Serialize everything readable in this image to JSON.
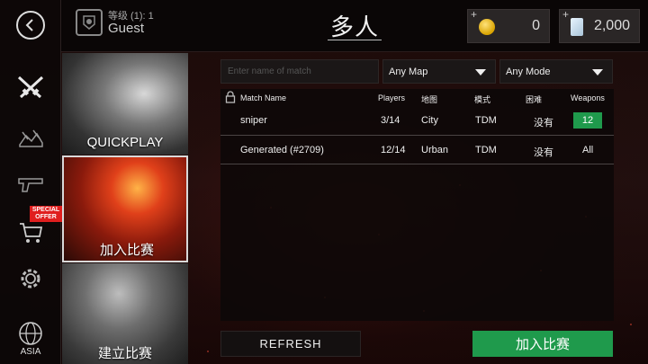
{
  "header": {
    "title": "多人",
    "profile": {
      "level": "等级 (1): 1",
      "name": "Guest"
    },
    "coins": {
      "plus": "+",
      "value": "0"
    },
    "cards": {
      "plus": "+",
      "value": "2,000"
    }
  },
  "sidebar": {
    "offer_badge": "SPECIAL OFFER",
    "region": "ASIA"
  },
  "modes": [
    {
      "label": "QUICKPLAY"
    },
    {
      "label": "加入比赛"
    },
    {
      "label": "建立比赛"
    }
  ],
  "filters": {
    "search_placeholder": "Enter name of match",
    "map": "Any Map",
    "mode": "Any Mode"
  },
  "table": {
    "columns": [
      "Match Name",
      "Players",
      "地图",
      "模式",
      "困难",
      "Weapons"
    ],
    "rows": [
      {
        "name": "sniper",
        "players": "3/14",
        "map": "City",
        "mode": "TDM",
        "difficulty": "没有",
        "weapons": "12"
      },
      {
        "name": "Generated (#2709)",
        "players": "12/14",
        "map": "Urban",
        "mode": "TDM",
        "difficulty": "没有",
        "weapons": "All"
      }
    ]
  },
  "buttons": {
    "refresh": "REFRESH",
    "join": "加入比赛"
  },
  "colors": {
    "accent_green": "#1f9a4c",
    "offer_red": "#e01e1e",
    "coin_gold": "#d9a300"
  }
}
